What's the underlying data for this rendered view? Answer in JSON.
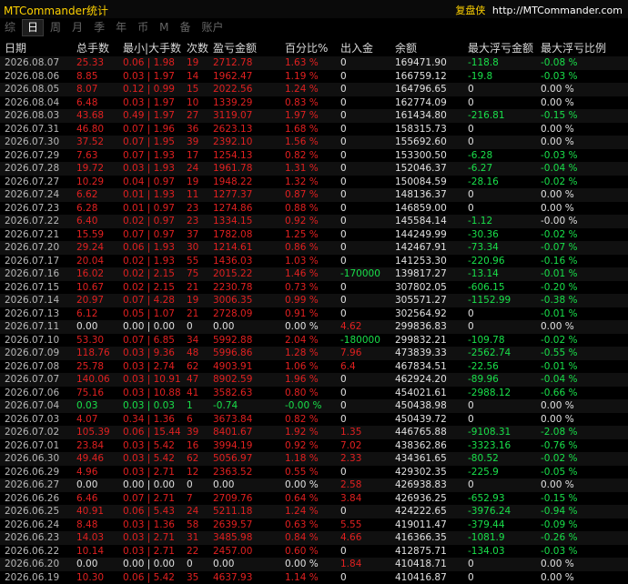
{
  "window": {
    "title": "MTCommander统计"
  },
  "brand": {
    "name": "复盘侠",
    "url": "http://MTCommander.com"
  },
  "tabs": [
    {
      "label": "综",
      "active": false
    },
    {
      "label": "日",
      "active": true
    },
    {
      "label": "周",
      "active": false
    },
    {
      "label": "月",
      "active": false
    },
    {
      "label": "季",
      "active": false
    },
    {
      "label": "年",
      "active": false
    },
    {
      "label": "币",
      "active": false
    },
    {
      "label": "M",
      "active": false
    },
    {
      "label": "备",
      "active": false
    },
    {
      "label": "账户",
      "active": false
    }
  ],
  "columns": [
    "日期",
    "总手数",
    "最小|大手数",
    "次数",
    "盈亏金额",
    "百分比%",
    "出入金",
    "余额",
    "最大浮亏金额",
    "最大浮亏比例"
  ],
  "colors": {
    "profit": "#e02020",
    "loss": "#19e04a",
    "neutral": "#e0e0e0",
    "title": "#ffd200"
  },
  "rows": [
    [
      "2026.08.07",
      "25.33",
      "0.06 | 1.98",
      "19",
      "2712.78",
      "1.63 %",
      "0",
      "169471.90",
      "-118.8",
      "-0.08 %"
    ],
    [
      "2026.08.06",
      "8.85",
      "0.03 | 1.97",
      "14",
      "1962.47",
      "1.19 %",
      "0",
      "166759.12",
      "-19.8",
      "-0.03 %"
    ],
    [
      "2026.08.05",
      "8.07",
      "0.12 | 0.99",
      "15",
      "2022.56",
      "1.24 %",
      "0",
      "164796.65",
      "0",
      "0.00 %"
    ],
    [
      "2026.08.04",
      "6.48",
      "0.03 | 1.97",
      "10",
      "1339.29",
      "0.83 %",
      "0",
      "162774.09",
      "0",
      "0.00 %"
    ],
    [
      "2026.08.03",
      "43.68",
      "0.49 | 1.97",
      "27",
      "3119.07",
      "1.97 %",
      "0",
      "161434.80",
      "-216.81",
      "-0.15 %"
    ],
    [
      "2026.07.31",
      "46.80",
      "0.07 | 1.96",
      "36",
      "2623.13",
      "1.68 %",
      "0",
      "158315.73",
      "0",
      "0.00 %"
    ],
    [
      "2026.07.30",
      "37.52",
      "0.07 | 1.95",
      "39",
      "2392.10",
      "1.56 %",
      "0",
      "155692.60",
      "0",
      "0.00 %"
    ],
    [
      "2026.07.29",
      "7.63",
      "0.07 | 1.93",
      "17",
      "1254.13",
      "0.82 %",
      "0",
      "153300.50",
      "-6.28",
      "-0.03 %"
    ],
    [
      "2026.07.28",
      "19.72",
      "0.03 | 1.93",
      "24",
      "1961.78",
      "1.31 %",
      "0",
      "152046.37",
      "-6.27",
      "-0.04 %"
    ],
    [
      "2026.07.27",
      "10.29",
      "0.04 | 0.97",
      "19",
      "1948.22",
      "1.32 %",
      "0",
      "150084.59",
      "-28.16",
      "-0.02 %"
    ],
    [
      "2026.07.24",
      "6.62",
      "0.01 | 1.93",
      "11",
      "1277.37",
      "0.87 %",
      "0",
      "148136.37",
      "0",
      "0.00 %"
    ],
    [
      "2026.07.23",
      "6.28",
      "0.01 | 0.97",
      "23",
      "1274.86",
      "0.88 %",
      "0",
      "146859.00",
      "0",
      "0.00 %"
    ],
    [
      "2026.07.22",
      "6.40",
      "0.02 | 0.97",
      "23",
      "1334.15",
      "0.92 %",
      "0",
      "145584.14",
      "-1.12",
      "-0.00 %"
    ],
    [
      "2026.07.21",
      "15.59",
      "0.07 | 0.97",
      "37",
      "1782.08",
      "1.25 %",
      "0",
      "144249.99",
      "-30.36",
      "-0.02 %"
    ],
    [
      "2026.07.20",
      "29.24",
      "0.06 | 1.93",
      "30",
      "1214.61",
      "0.86 %",
      "0",
      "142467.91",
      "-73.34",
      "-0.07 %"
    ],
    [
      "2026.07.17",
      "20.04",
      "0.02 | 1.93",
      "55",
      "1436.03",
      "1.03 %",
      "0",
      "141253.30",
      "-220.96",
      "-0.16 %"
    ],
    [
      "2026.07.16",
      "16.02",
      "0.02 | 2.15",
      "75",
      "2015.22",
      "1.46 %",
      "-170000",
      "139817.27",
      "-13.14",
      "-0.01 %"
    ],
    [
      "2026.07.15",
      "10.67",
      "0.02 | 2.15",
      "21",
      "2230.78",
      "0.73 %",
      "0",
      "307802.05",
      "-606.15",
      "-0.20 %"
    ],
    [
      "2026.07.14",
      "20.97",
      "0.07 | 4.28",
      "19",
      "3006.35",
      "0.99 %",
      "0",
      "305571.27",
      "-1152.99",
      "-0.38 %"
    ],
    [
      "2026.07.13",
      "6.12",
      "0.05 | 1.07",
      "21",
      "2728.09",
      "0.91 %",
      "0",
      "302564.92",
      "0",
      "-0.01 %"
    ],
    [
      "2026.07.11",
      "0.00",
      "0.00 | 0.00",
      "0",
      "0.00",
      "0.00 %",
      "4.62",
      "299836.83",
      "0",
      "0.00 %"
    ],
    [
      "2026.07.10",
      "53.30",
      "0.07 | 6.85",
      "34",
      "5992.88",
      "2.04 %",
      "-180000",
      "299832.21",
      "-109.78",
      "-0.02 %"
    ],
    [
      "2026.07.09",
      "118.76",
      "0.03 | 9.36",
      "48",
      "5996.86",
      "1.28 %",
      "7.96",
      "473839.33",
      "-2562.74",
      "-0.55 %"
    ],
    [
      "2026.07.08",
      "25.78",
      "0.03 | 2.74",
      "62",
      "4903.91",
      "1.06 %",
      "6.4",
      "467834.51",
      "-22.56",
      "-0.01 %"
    ],
    [
      "2026.07.07",
      "140.06",
      "0.03 | 10.91",
      "47",
      "8902.59",
      "1.96 %",
      "0",
      "462924.20",
      "-89.96",
      "-0.04 %"
    ],
    [
      "2026.07.06",
      "75.16",
      "0.03 | 10.88",
      "41",
      "3582.63",
      "0.80 %",
      "0",
      "454021.61",
      "-2988.12",
      "-0.66 %"
    ],
    [
      "2026.07.04",
      "0.03",
      "0.03 | 0.03",
      "1",
      "-0.74",
      "-0.00 %",
      "0",
      "450438.98",
      "0",
      "0.00 %"
    ],
    [
      "2026.07.03",
      "4.07",
      "0.34 | 1.36",
      "6",
      "3673.84",
      "0.82 %",
      "0",
      "450439.72",
      "0",
      "0.00 %"
    ],
    [
      "2026.07.02",
      "105.39",
      "0.06 | 15.44",
      "39",
      "8401.67",
      "1.92 %",
      "1.35",
      "446765.88",
      "-9108.31",
      "-2.08 %"
    ],
    [
      "2026.07.01",
      "23.84",
      "0.03 | 5.42",
      "16",
      "3994.19",
      "0.92 %",
      "7.02",
      "438362.86",
      "-3323.16",
      "-0.76 %"
    ],
    [
      "2026.06.30",
      "49.46",
      "0.03 | 5.42",
      "62",
      "5056.97",
      "1.18 %",
      "2.33",
      "434361.65",
      "-80.52",
      "-0.02 %"
    ],
    [
      "2026.06.29",
      "4.96",
      "0.03 | 2.71",
      "12",
      "2363.52",
      "0.55 %",
      "0",
      "429302.35",
      "-225.9",
      "-0.05 %"
    ],
    [
      "2026.06.27",
      "0.00",
      "0.00 | 0.00",
      "0",
      "0.00",
      "0.00 %",
      "2.58",
      "426938.83",
      "0",
      "0.00 %"
    ],
    [
      "2026.06.26",
      "6.46",
      "0.07 | 2.71",
      "7",
      "2709.76",
      "0.64 %",
      "3.84",
      "426936.25",
      "-652.93",
      "-0.15 %"
    ],
    [
      "2026.06.25",
      "40.91",
      "0.06 | 5.43",
      "24",
      "5211.18",
      "1.24 %",
      "0",
      "424222.65",
      "-3976.24",
      "-0.94 %"
    ],
    [
      "2026.06.24",
      "8.48",
      "0.03 | 1.36",
      "58",
      "2639.57",
      "0.63 %",
      "5.55",
      "419011.47",
      "-379.44",
      "-0.09 %"
    ],
    [
      "2026.06.23",
      "14.03",
      "0.03 | 2.71",
      "31",
      "3485.98",
      "0.84 %",
      "4.66",
      "416366.35",
      "-1081.9",
      "-0.26 %"
    ],
    [
      "2026.06.22",
      "10.14",
      "0.03 | 2.71",
      "22",
      "2457.00",
      "0.60 %",
      "0",
      "412875.71",
      "-134.03",
      "-0.03 %"
    ],
    [
      "2026.06.20",
      "0.00",
      "0.00 | 0.00",
      "0",
      "0.00",
      "0.00 %",
      "1.84",
      "410418.71",
      "0",
      "0.00 %"
    ],
    [
      "2026.06.19",
      "10.30",
      "0.06 | 5.42",
      "35",
      "4637.93",
      "1.14 %",
      "0",
      "410416.87",
      "0",
      "0.00 %"
    ]
  ]
}
